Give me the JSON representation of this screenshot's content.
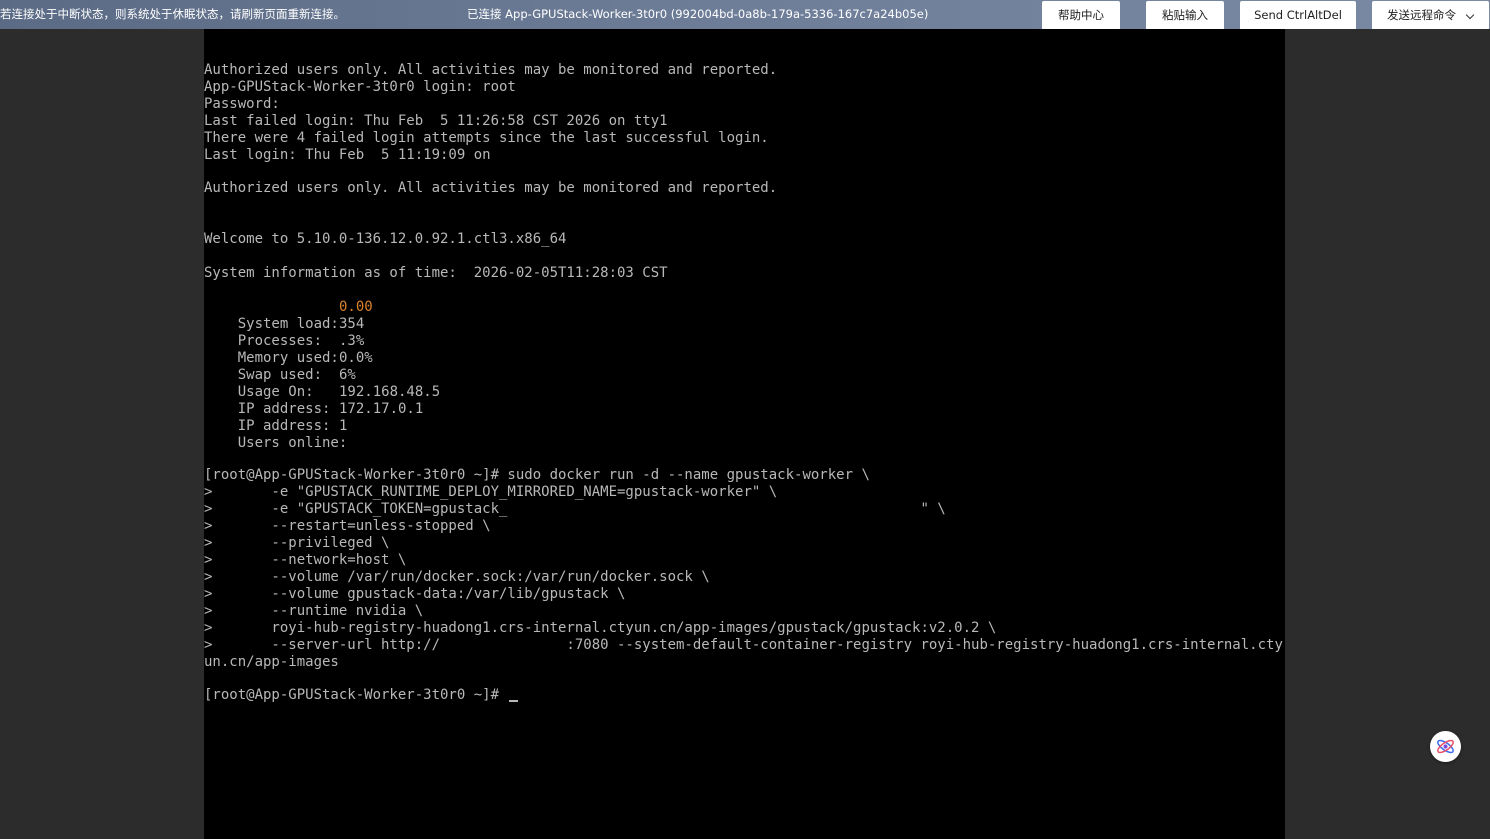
{
  "topbar": {
    "notice": "若连接处于中断状态，则系统处于休眠状态，请刷新页面重新连接。",
    "connection_title": "已连接 App-GPUStack-Worker-3t0r0 (992004bd-0a8b-179a-5336-167c7a24b05e)",
    "buttons": {
      "help": "帮助中心",
      "paste": "粘贴输入",
      "ctrl_alt_del": "Send CtrlAltDel",
      "remote_cmd": "发送远程命令"
    }
  },
  "terminal": {
    "colors": {
      "text": "#b8b8b8",
      "highlight": "#d9822b",
      "background": "#000000"
    },
    "lines": [
      "Authorized users only. All activities may be monitored and reported.",
      "App-GPUStack-Worker-3t0r0 login: root",
      "Password:",
      "Last failed login: Thu Feb  5 11:26:58 CST 2026 on tty1",
      "There were 4 failed login attempts since the last successful login.",
      "Last login: Thu Feb  5 11:19:09 on",
      "Authorized users only. All activities may be monitored and reported.",
      "Welcome to 5.10.0-136.12.0.92.1.ctl3.x86_64",
      "System information as of time:  2026-02-05T11:28:03 CST"
    ],
    "sysinfo": [
      {
        "label": "System load:",
        "value": "0.00"
      },
      {
        "label": "Processes:",
        "value": "354"
      },
      {
        "label": "Memory used:",
        "value": ".3%"
      },
      {
        "label": "Swap used:",
        "value": "0.0%"
      },
      {
        "label": "Usage On:",
        "value": "6%"
      },
      {
        "label": "IP address:",
        "value": "192.168.48.5"
      },
      {
        "label": "IP address:",
        "value": "172.17.0.1"
      },
      {
        "label": "Users online:",
        "value": "1"
      }
    ],
    "command": [
      "[root@App-GPUStack-Worker-3t0r0 ~]# sudo docker run -d --name gpustack-worker \\",
      ">       -e \"GPUSTACK_RUNTIME_DEPLOY_MIRRORED_NAME=gpustack-worker\" \\",
      ">       -e \"GPUSTACK_TOKEN=gpustack_                                                 \" \\",
      ">       --restart=unless-stopped \\",
      ">       --privileged \\",
      ">       --network=host \\",
      ">       --volume /var/run/docker.sock:/var/run/docker.sock \\",
      ">       --volume gpustack-data:/var/lib/gpustack \\",
      ">       --runtime nvidia \\",
      ">       royi-hub-registry-huadong1.crs-internal.ctyun.cn/app-images/gpustack/gpustack:v2.0.2 \\",
      ">       --server-url http://               :7080 --system-default-container-registry royi-hub-registry-huadong1.crs-internal.cty",
      "un.cn/app-images"
    ],
    "prompt": "[root@App-GPUStack-Worker-3t0r0 ~]# "
  },
  "icons": {
    "dropdown": "chevron-down-icon",
    "assistant": "assistant-logo-icon"
  }
}
